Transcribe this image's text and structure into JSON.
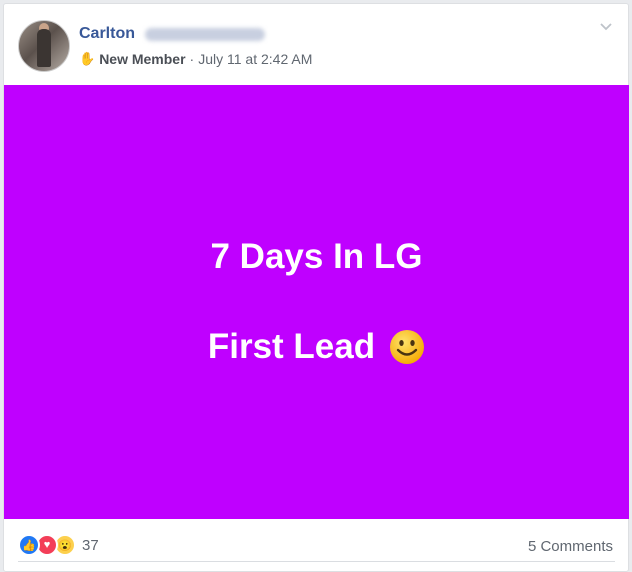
{
  "post": {
    "author_first": "Carlton",
    "badge": "New Member",
    "separator": "·",
    "timestamp": "July 11 at 2:42 AM"
  },
  "banner": {
    "line1": "7 Days In LG",
    "line2": "First Lead",
    "background": "#bf00ff"
  },
  "footer": {
    "reactions": [
      "like-icon",
      "love-icon",
      "wow-icon"
    ],
    "reaction_count": "37",
    "comments": "5 Comments"
  }
}
